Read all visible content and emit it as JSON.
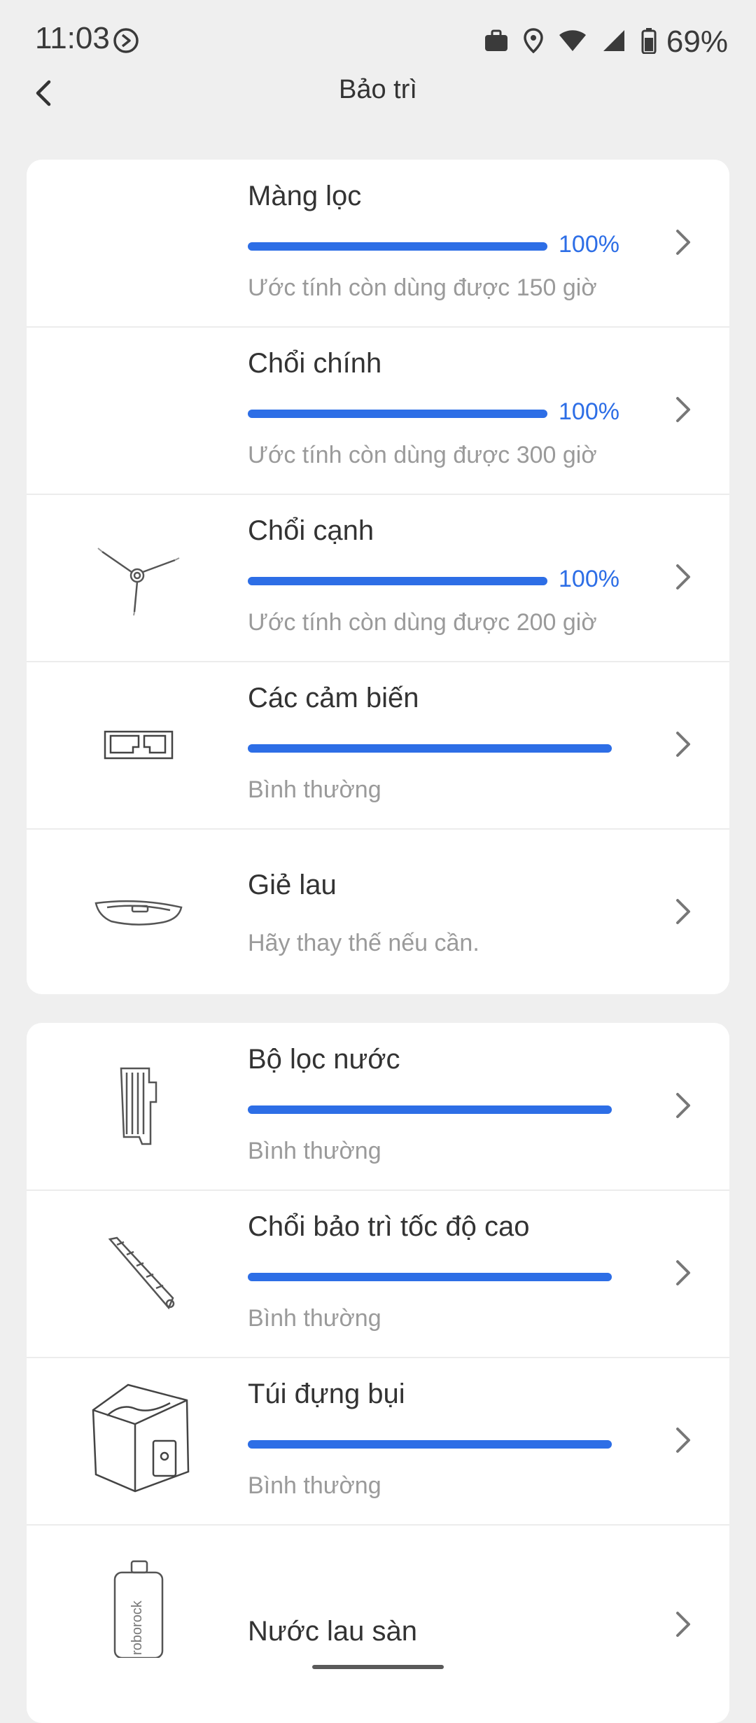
{
  "status_bar": {
    "time": "11:03",
    "battery": "69%"
  },
  "header": {
    "title": "Bảo trì"
  },
  "card1": [
    {
      "title": "Màng lọc",
      "progress": 100,
      "percent": "100%",
      "subtitle": "Ước tính còn dùng được 150 giờ",
      "icon": "filter-image"
    },
    {
      "title": "Chổi chính",
      "progress": 100,
      "percent": "100%",
      "subtitle": "Ước tính còn dùng được 300 giờ",
      "icon": "main-brush-image"
    },
    {
      "title": "Chổi cạnh",
      "progress": 100,
      "percent": "100%",
      "subtitle": "Ước tính còn dùng được 200 giờ",
      "icon": "side-brush-image"
    },
    {
      "title": "Các cảm biến",
      "progress": 100,
      "subtitle": "Bình thường",
      "icon": "sensor-image"
    },
    {
      "title": "Giẻ lau",
      "subtitle": "Hãy thay thế nếu cần.",
      "icon": "mop-image"
    }
  ],
  "card2": [
    {
      "title": "Bộ lọc nước",
      "progress": 100,
      "subtitle": "Bình thường",
      "icon": "water-filter-image"
    },
    {
      "title": "Chổi bảo trì tốc độ cao",
      "progress": 100,
      "subtitle": "Bình thường",
      "icon": "cleaning-brush-image"
    },
    {
      "title": "Túi đựng bụi",
      "progress": 100,
      "subtitle": "Bình thường",
      "icon": "dust-bag-image"
    },
    {
      "title": "Nước lau sàn",
      "icon": "floor-cleaner-bottle-image",
      "bottle_label": "roborock"
    }
  ],
  "colors": {
    "accent": "#2d6ee6",
    "background": "#efefef"
  }
}
